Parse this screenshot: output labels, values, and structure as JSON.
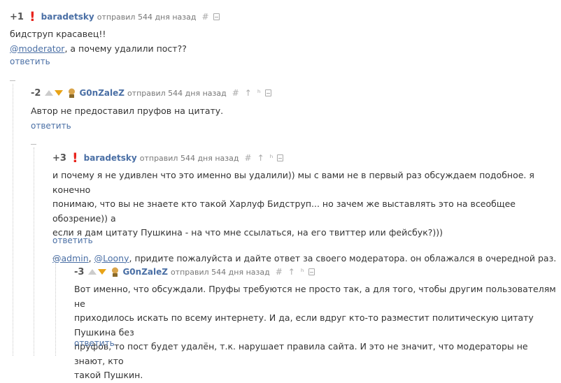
{
  "comments": [
    {
      "score": "+1",
      "author": "baradetsky",
      "meta": "отправил 544 дня назад",
      "lines": [
        "бидструп красавец!!"
      ],
      "mention": "@moderator",
      "mention_tail": ",  а почему удалили пост??",
      "reply": "ответить"
    },
    {
      "score": "-2",
      "author": "G0nZaleZ",
      "meta": "отправил 544 дня назад",
      "lines": [
        "Автор не предоставил пруфов на цитату."
      ],
      "reply": "ответить"
    },
    {
      "score": "+3",
      "author": "baradetsky",
      "meta": "отправил 544 дня назад",
      "lines": [
        "и почему я не удивлен что это именно вы удалили)) мы с вами не в первый раз обсуждаем подобное. я конечно",
        "понимаю, что вы не знаете кто такой Харлуф Бидструп... но зачем же выставлять это на всеобщее обозрение)) а",
        "если я дам цитату Пушкина - на что мне ссылаться, на его твиттер или фейсбук?)))"
      ],
      "mention1": "@admin",
      "mention_sep": ", ",
      "mention2": "@Loony",
      "mention_tail": ", придите пожалуйста и дайте ответ за своего модератора. он облажался в очередной раз.",
      "reply": "ответить"
    },
    {
      "score": "-3",
      "author": "G0nZaleZ",
      "meta": "отправил 544 дня назад",
      "lines": [
        "Вот именно, что обсуждали. Пруфы требуются не просто так, а для того, чтобы другим пользователям не",
        "приходилось искать по всему интернету. И да, если вдруг кто-то разместит политическую цитату Пушкина без",
        "пруфов, то пост будет удалён, т.к. нарушает правила сайта. И это не значит, что модераторы не знают, кто",
        "такой Пушкин."
      ],
      "reply": "ответить"
    }
  ],
  "icons": {
    "hash": "#",
    "up_arrow": "↑",
    "parent": "ʰ"
  },
  "colors": {
    "author": "#4a6fa5",
    "bang": "#e8231c",
    "vote_down": "#e8a317"
  }
}
